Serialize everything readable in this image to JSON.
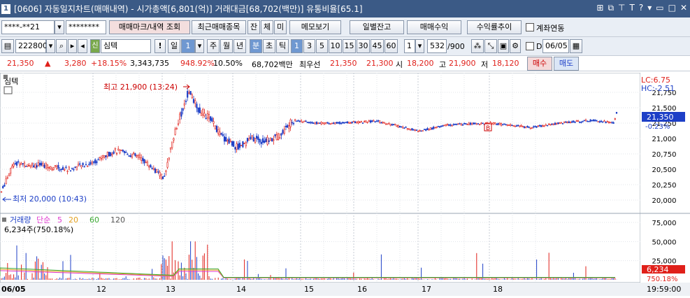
{
  "window": {
    "number": "1",
    "title": "[0606] 자동일지차트(매매내역) - 시가총액[6,801(억)] 거래대금[68,702(백만)] 유통비율[65.1]"
  },
  "toolbar1": {
    "account": "****-**21",
    "password": "********",
    "btn_trade_mark": "매매마크/내역 조회",
    "btn_recent": "최근매매종목",
    "btn_jan": "잔",
    "btn_che": "체",
    "btn_mi": "미",
    "btn_memo": "메모보기",
    "btn_daily": "일별잔고",
    "btn_pl": "매매수익",
    "btn_return": "수익률추이",
    "chk_account_link": "계좌연동"
  },
  "toolbar2": {
    "code": "222800",
    "stock_name": "심텍",
    "badge": "신",
    "period_day": "일",
    "period_num": "1",
    "p_week": "주",
    "p_month": "월",
    "p_year": "년",
    "p_min": "분",
    "p_tick": "초",
    "p_tick2": "틱",
    "intervals": [
      "1",
      "3",
      "5",
      "10",
      "15",
      "30",
      "45",
      "60"
    ],
    "unit": "1",
    "count": "532",
    "count_max": "/900",
    "date_flag": "D",
    "date": "06/05"
  },
  "quote": {
    "price": "21,350",
    "arrow": "▲",
    "change": "3,280",
    "pct": "+18.15%",
    "volume": "3,343,735",
    "vol_ratio": "948.92%",
    "turnover": "10.50%",
    "amount": "68,702백만",
    "best_ask_label": "최우선",
    "best_ask": "21,350",
    "best_bid": "21,300",
    "open_label": "시",
    "open": "18,200",
    "high_label": "고",
    "high": "21,900",
    "low_label": "저",
    "low": "18,120",
    "buy": "매수",
    "sell": "매도"
  },
  "chart": {
    "stock_label": "심텍",
    "high_annot": "최고 21,900 (13:24)",
    "low_annot": "최저 20,000 (10:43)",
    "lc": "LC:6.75",
    "hc": "HC:-2.51",
    "price_ticks": [
      "21,750",
      "21,500",
      "21,250",
      "21,000",
      "20,750",
      "20,500",
      "20,250",
      "20,000"
    ],
    "current_price": "21,350",
    "current_pct": "-0.23%",
    "marker": "B"
  },
  "volume_panel": {
    "legend": [
      "거래량",
      "단순",
      "5",
      "20",
      "60",
      "120"
    ],
    "info": "6,234주(750.18%)",
    "ticks": [
      "75,000",
      "50,000",
      "25,000"
    ],
    "current": "6,234",
    "current_pct": "750.18%"
  },
  "xaxis": {
    "labels": [
      "06/05",
      "12",
      "13",
      "14",
      "15",
      "16",
      "17",
      "18"
    ],
    "time": "19:59:00"
  },
  "chart_data": {
    "type": "candlestick",
    "x": [
      "06/05 10:43",
      "13:24"
    ],
    "low": 20000,
    "high": 21900,
    "last": 21350,
    "volume_max_tick": 75000,
    "ylim": [
      19900,
      22000
    ]
  }
}
